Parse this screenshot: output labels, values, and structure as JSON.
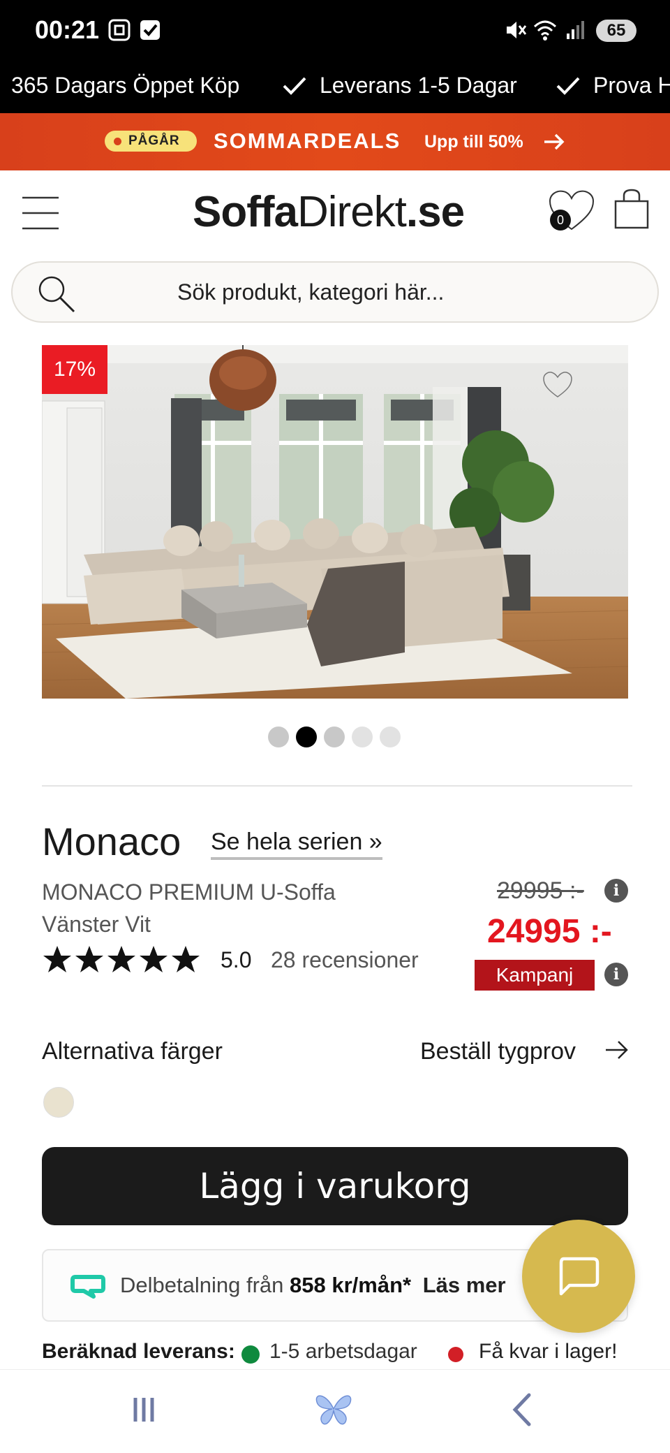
{
  "status_bar": {
    "time": "00:21",
    "battery": "65"
  },
  "ticker": {
    "items": [
      "365 Dagars Öppet Köp",
      "Leverans 1-5 Dagar",
      "Prova H"
    ]
  },
  "promo": {
    "pill": "PÅGÅR",
    "title": "SOMMARDEALS",
    "subtitle": "Upp till 50%"
  },
  "header": {
    "logo_bold": "Soffa",
    "logo_rest": "Direkt",
    "logo_tld": ".se",
    "wishlist_count": "0"
  },
  "search": {
    "placeholder": "Sök produkt, kategori här..."
  },
  "gallery": {
    "discount_badge": "17%",
    "active_index": 1,
    "dot_count": 5
  },
  "product": {
    "name": "Monaco",
    "series_link": "Se hela serien »",
    "subtitle": "MONACO PREMIUM U-Soffa Vänster Vit",
    "rating": "5.0",
    "stars": 5,
    "reviews": "28 recensioner",
    "old_price": "29995 :-",
    "new_price": "24995 :-",
    "campaign_label": "Kampanj"
  },
  "options": {
    "alt_colors_label": "Alternativa färger",
    "fabric_sample_link": "Beställ tygprov",
    "swatch_color": "#e9e2cf"
  },
  "cart": {
    "button_label": "Lägg i varukorg"
  },
  "payment": {
    "text_prefix": "Delbetalning från",
    "amount": "858 kr/mån*",
    "read_more": "Läs mer"
  },
  "delivery": {
    "label": "Beräknad leverans:",
    "time": "1-5 arbetsdagar",
    "stock": "Få kvar i lager!"
  },
  "colors": {
    "promo": "#e24a1a",
    "price_red": "#e3161f",
    "campaign": "#b3141a",
    "chat": "#d6b94f",
    "in_stock": "#0f8a3e",
    "low_stock": "#d21f26"
  }
}
